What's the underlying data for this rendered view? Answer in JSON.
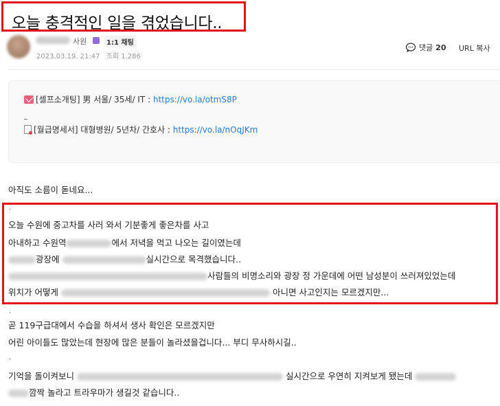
{
  "post": {
    "title": "오늘 충격적인 일을 겪었습니다..",
    "author_rank": "사원",
    "chat_label": "1:1 채팅",
    "date": "2023.03.19. 21:47",
    "views": "조회 1,286"
  },
  "actions": {
    "comment_label": "댓글",
    "comment_count": "20",
    "url_copy": "URL 복사"
  },
  "info": {
    "line1_text": "[셀프소개팅] 男 서울/ 35세/ IT : ",
    "line1_link": "https://vo.la/otmS8P",
    "dash": "_",
    "line2_text": "[월급명세서] 대형병원/ 5년차/ 간호사 : ",
    "line2_link": "https://vo.la/nOqJKm"
  },
  "content": {
    "p1": "아직도 소름이 돋네요...",
    "p2": "오늘 수원에 중고차를 사러 와서 기분좋게 좋은차를 사고",
    "p3a": "아내하고 수원역",
    "p3b": "에서 저녁을 먹고 나오는 길이였는데",
    "p4a": "광장에",
    "p4b": "실시간으로 목격했습니다..",
    "p5": "사람들의 비명소리와 광장 정 가운데에 어떤 남성분이 쓰러져있었는데",
    "p6a": "위치가 어떻게",
    "p6b": "아니면 사고인지는 모르겠지만...",
    "p7": "곧 119구급대에서 수습을 하셔서 생사 확인은 모르겠지만",
    "p8": "어린 아이들도 많았는데 현장에 많은 분들이 놀라셨을겁니다... 부디 무사하시길..",
    "p9a": "기억을 돌이켜보니",
    "p9b": "실시간으로 우연히 지켜보게 됐는데",
    "p10": "깜짝 놀라고 트라우마가 생길것 같습니다.."
  },
  "icons": {
    "comment": "speech-bubble-icon",
    "mail": "envelope-icon",
    "doc": "document-icon"
  },
  "colors": {
    "highlight_red": "#e1121b",
    "link_blue": "#2e7bcf",
    "badge_purple": "#8e6cd9"
  }
}
